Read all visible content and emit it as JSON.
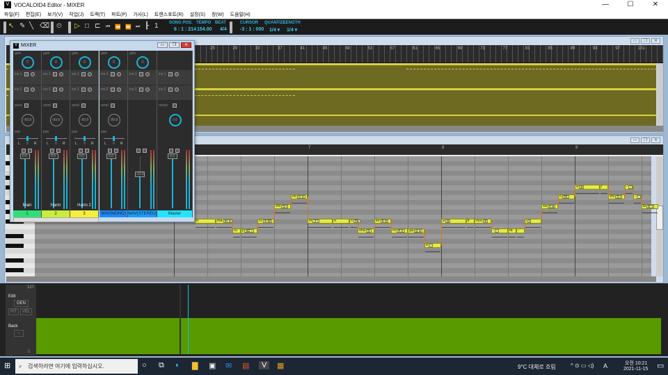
{
  "window": {
    "title": "VOCALOID4 Editor - MIXER",
    "app_icon": "V",
    "minimize": "—",
    "maximize": "☐",
    "close": "✕"
  },
  "menu": [
    "파일(F)",
    "편집(E)",
    "보기(V)",
    "작업(J)",
    "트랙(T)",
    "파트(P)",
    "가사(L)",
    "트랜스포트(R)",
    "설정(S)",
    "창(W)",
    "도움말(H)"
  ],
  "toolbar": {
    "song_pos_label": "SONG POS.",
    "song_pos": "6 : 1 : 214",
    "tempo_label": "TEMPO",
    "tempo": "154.00",
    "beat_label": "BEAT",
    "beat": "4/4",
    "cursor_label": "CURSOR",
    "cursor": "-3 : 1 : 000",
    "quantize_label": "QUANTIZE",
    "quantize": "1/4 ▾",
    "length_label": "LENGTH",
    "length": "1/4 ▾"
  },
  "track_ruler": [
    "25",
    "29",
    "33",
    "37",
    "41",
    "45",
    "49",
    "53",
    "57",
    "61",
    "65",
    "69",
    "73",
    "77",
    "81",
    "85",
    "89",
    "93",
    "97",
    "101"
  ],
  "roll_ruler": [
    "7",
    "8",
    "9"
  ],
  "mixer": {
    "title": "MIXER",
    "labels": {
      "gain": "gain",
      "ins1": "ins 1",
      "ins2": "ins 2",
      "send": "send",
      "ret": "return",
      "pan": "pan",
      "L": "L",
      "R": "R",
      "zero": "0"
    },
    "channels": [
      {
        "name": "Main",
        "tag": "1",
        "color": "#2fe07a",
        "gain": "0",
        "send": "-89.8",
        "fader": "0.0"
      },
      {
        "name": "Harm",
        "tag": "2",
        "color": "#c8ee3a",
        "gain": "0",
        "send": "-89.8",
        "fader": "0.0"
      },
      {
        "name": "Harm 2",
        "tag": "3",
        "color": "#f6ee3c",
        "gain": "0",
        "send": "-89.8",
        "fader": "0.0"
      },
      {
        "name": "",
        "tag": "WAV(MONO)",
        "color": "#1a8cff",
        "gain": "0",
        "send": "-89.8",
        "fader": "0.0"
      },
      {
        "name": "",
        "tag": "WAV(STEREO)",
        "color": "#1c9cff",
        "gain": "0",
        "send": "",
        "fader": "-12.9"
      },
      {
        "name": "",
        "tag": "Master",
        "color": "#22e4ff",
        "gain": "",
        "send": "0.0",
        "fader": "0.0"
      }
    ]
  },
  "notes_pitch_base": 66,
  "notes": [
    {
      "start": 0.625,
      "len": 0.625,
      "pitch": 66,
      "lyric": "n",
      "phon": ""
    },
    {
      "start": 1.25,
      "len": 0.5,
      "pitch": 66,
      "lyric": "ma",
      "phon": "m a"
    },
    {
      "start": 1.75,
      "len": 0.25,
      "pitch": 64,
      "lyric": "ru",
      "phon": ""
    },
    {
      "start": 2,
      "len": 0.5,
      "pitch": 64,
      "lyric": "ji",
      "phon": "dZ i"
    },
    {
      "start": 2.5,
      "len": 0.5,
      "pitch": 66,
      "lyric": "ru",
      "phon": "4 M"
    },
    {
      "start": 3,
      "len": 0.5,
      "pitch": 69,
      "lyric": "shi",
      "phon": "S i"
    },
    {
      "start": 3.5,
      "len": 0.5,
      "pitch": 71,
      "lyric": "no",
      "phon": "n o"
    },
    {
      "start": 4,
      "len": 0.75,
      "pitch": 66,
      "lyric": "ni",
      "phon": "J i"
    },
    {
      "start": 4.75,
      "len": 0.5,
      "pitch": 66,
      "lyric": "n",
      "phon": ""
    },
    {
      "start": 5.25,
      "len": 0.25,
      "pitch": 66,
      "lyric": "n",
      "phon": "N\\"
    },
    {
      "start": 5.5,
      "len": 0.5,
      "pitch": 64,
      "lyric": "sha",
      "phon": "S"
    },
    {
      "start": 6,
      "len": 0.5,
      "pitch": 66,
      "lyric": "ko",
      "phon": "k o"
    },
    {
      "start": 6.5,
      "len": 0.5,
      "pitch": 64,
      "lyric": "ro",
      "phon": "4 o"
    },
    {
      "start": 7,
      "len": 0.5,
      "pitch": 64,
      "lyric": "ga",
      "phon": "g a"
    },
    {
      "start": 7.5,
      "len": 0.5,
      "pitch": 61,
      "lyric": "e",
      "phon": "-"
    },
    {
      "start": 8,
      "len": 0.75,
      "pitch": 66,
      "lyric": "a",
      "phon": "a"
    },
    {
      "start": 8.75,
      "len": 0.25,
      "pitch": 66,
      "lyric": "k",
      "phon": ""
    },
    {
      "start": 9,
      "len": 0.5,
      "pitch": 66,
      "lyric": "nyo",
      "phon": "4"
    },
    {
      "start": 9.5,
      "len": 0.5,
      "pitch": 64,
      "lyric": "-",
      "phon": "-"
    },
    {
      "start": 10,
      "len": 0.25,
      "pitch": 64,
      "lyric": "ta",
      "phon": ""
    },
    {
      "start": 10.25,
      "len": 0.25,
      "pitch": 64,
      "lyric": "-",
      "phon": ""
    },
    {
      "start": 10.5,
      "len": 0.5,
      "pitch": 66,
      "lyric": "i",
      "phon": "i"
    },
    {
      "start": 11,
      "len": 0.5,
      "pitch": 69,
      "lyric": "sa",
      "phon": "s a"
    },
    {
      "start": 11.5,
      "len": 0.5,
      "pitch": 71,
      "lyric": "n",
      "phon": "N\\"
    },
    {
      "start": 12,
      "len": 0.75,
      "pitch": 73,
      "lyric": "a",
      "phon": "a"
    },
    {
      "start": 12.75,
      "len": 0.25,
      "pitch": 73,
      "lyric": "i",
      "phon": ""
    },
    {
      "start": 13,
      "len": 0.5,
      "pitch": 71,
      "lyric": "shi",
      "phon": "S i"
    },
    {
      "start": 13.5,
      "len": 0.25,
      "pitch": 73,
      "lyric": "-",
      "phon": "-"
    },
    {
      "start": 13.75,
      "len": 0.25,
      "pitch": 71,
      "lyric": "-",
      "phon": "-"
    },
    {
      "start": 14,
      "len": 0.5,
      "pitch": 69,
      "lyric": "bi",
      "phon": "b' i"
    }
  ],
  "control": {
    "max": "127",
    "min": "0",
    "edit_label": "Edit",
    "edit_value": "GEN",
    "pit": "PIT",
    "vel": "VEL",
    "back_label": "Back",
    "back_value": "-"
  },
  "taskbar": {
    "search_placeholder": "검색하려면 여기에 입력하십시오.",
    "weather": "9°C  대체로 흐림",
    "ime": "A",
    "time": "오전 10:21",
    "date": "2021-11-15"
  }
}
